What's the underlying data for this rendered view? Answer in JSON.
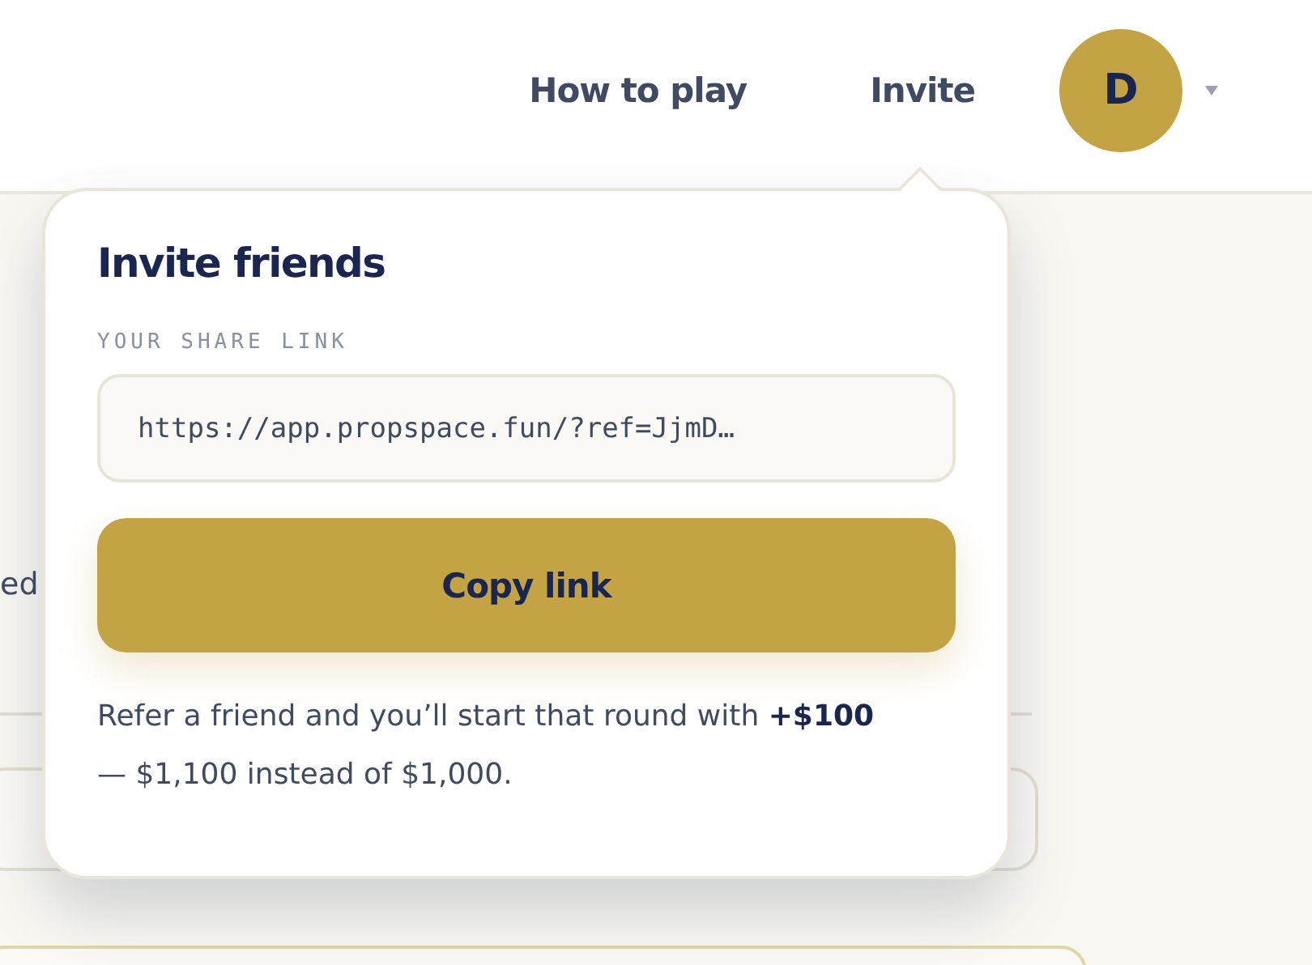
{
  "nav": [
    {
      "label": "How to play"
    },
    {
      "label": "Invite"
    }
  ],
  "avatar": {
    "initial": "D"
  },
  "background": {
    "partial_text": "ed"
  },
  "invite_popover": {
    "title": "Invite friends",
    "link_label": "YOUR SHARE LINK",
    "link_value": "https://app.propspace.fun/?ref=JjmD…",
    "button": "Copy link",
    "note": "Refer a friend and you’ll start that round with **+$100** — $1,100 instead of $1,000."
  }
}
